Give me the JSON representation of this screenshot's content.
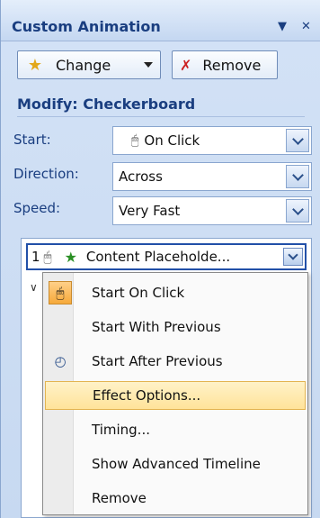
{
  "panel": {
    "title": "Custom Animation",
    "dropdown_icon": "▼",
    "close_icon": "✕"
  },
  "toolbar": {
    "change_label": "Change",
    "remove_label": "Remove"
  },
  "modify": {
    "heading": "Modify: Checkerboard",
    "start_label": "Start:",
    "start_value": "On Click",
    "direction_label": "Direction:",
    "direction_value": "Across",
    "speed_label": "Speed:",
    "speed_value": "Very Fast"
  },
  "list": {
    "item_number": "1",
    "item_text": "Content Placeholde..."
  },
  "menu": {
    "items": [
      "Start On Click",
      "Start With Previous",
      "Start After Previous",
      "Effect Options...",
      "Timing...",
      "Show Advanced Timeline",
      "Remove"
    ]
  }
}
